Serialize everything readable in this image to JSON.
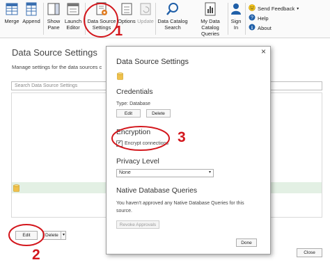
{
  "ribbon": {
    "merge": "Merge",
    "append": "Append",
    "show_pane_1": "Show",
    "show_pane_2": "Pane",
    "launch_editor_1": "Launch",
    "launch_editor_2": "Editor",
    "ds_settings_1": "Data Source",
    "ds_settings_2": "Settings",
    "options": "Options",
    "update": "Update",
    "catalog_search_1": "Data Catalog",
    "catalog_search_2": "Search",
    "my_queries_1": "My Data",
    "my_queries_2": "Catalog Queries",
    "sign_in_1": "Sign",
    "sign_in_2": "In",
    "send_feedback": "Send Feedback",
    "help": "Help",
    "about": "About"
  },
  "background": {
    "title": "Data Source Settings",
    "description": "Manage settings for the data sources c",
    "search_placeholder": "Search Data Source Settings",
    "edit": "Edit",
    "delete": "Delete",
    "close": "Close"
  },
  "dialog": {
    "title": "Data Source Settings",
    "close_glyph": "×",
    "credentials_heading": "Credentials",
    "type_text": "Type: Database",
    "edit": "Edit",
    "delete": "Delete",
    "encryption_heading": "Encryption",
    "encrypt_label": "Encrypt connections",
    "encrypt_checked": true,
    "privacy_heading": "Privacy Level",
    "privacy_value": "None",
    "native_heading": "Native Database Queries",
    "native_text_1": "You haven't approved any Native Database Queries for this",
    "native_text_2": "source.",
    "revoke": "Revoke Approvals",
    "done": "Done"
  },
  "annotations": {
    "n1": "1",
    "n2": "2",
    "n3": "3",
    "color": "#d3161c"
  }
}
